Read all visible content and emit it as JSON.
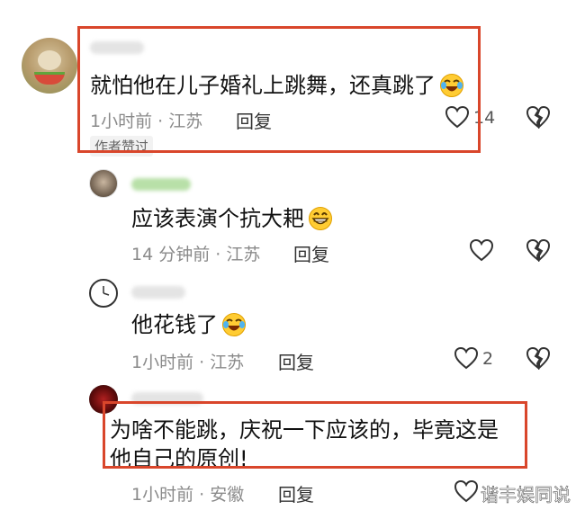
{
  "comments": [
    {
      "text": "就怕他在儿子婚礼上跳舞，还真跳了",
      "time": "1小时前",
      "location": "江苏",
      "reply_label": "回复",
      "likes": "14",
      "badge": "作者赞过",
      "emoji": "laughing-tears-emoji"
    },
    {
      "text": "应该表演个抗大耙",
      "time": "14 分钟前",
      "location": "江苏",
      "reply_label": "回复",
      "likes": "",
      "emoji": "grin-emoji"
    },
    {
      "text": "他花钱了",
      "time": "1小时前",
      "location": "江苏",
      "reply_label": "回复",
      "likes": "2",
      "emoji": "laughing-tears-emoji"
    },
    {
      "text_line1": "为啥不能跳，庆祝一下应该的，毕竟这是",
      "text_line2": "他自己的原创!",
      "time": "1小时前",
      "location": "安徽",
      "reply_label": "回复",
      "likes": ""
    }
  ],
  "separator": "·",
  "watermark": "谐丰娱同说",
  "colors": {
    "highlight_box": "#d9462b",
    "meta_text": "#8a8a8a",
    "icon_stroke": "#333333"
  }
}
